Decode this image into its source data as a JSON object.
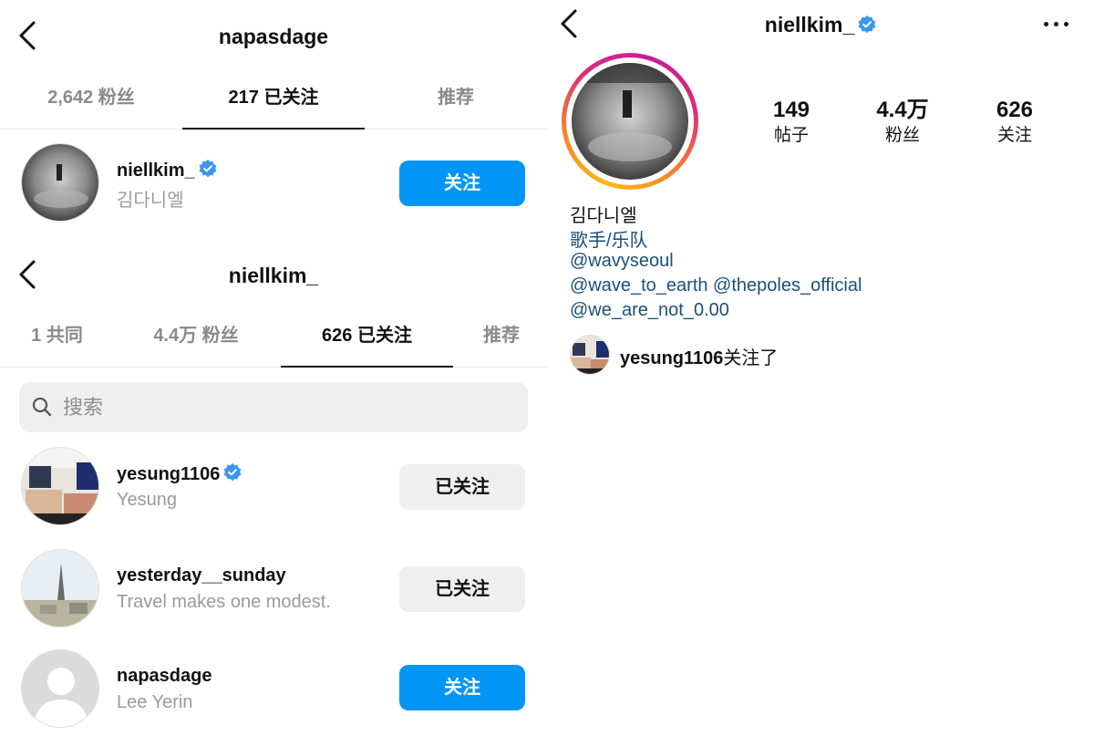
{
  "screen1": {
    "title": "napasdage",
    "tabs": [
      {
        "label": "2,642 粉丝",
        "active": false
      },
      {
        "label": "217 已关注",
        "active": true
      },
      {
        "label": "推荐",
        "active": false
      }
    ],
    "user": {
      "username": "niellkim_",
      "subtitle": "김다니엘",
      "verified": true,
      "button": "关注"
    }
  },
  "screen2": {
    "title": "niellkim_",
    "tabs": [
      {
        "label": "1 共同",
        "active": false
      },
      {
        "label": "4.4万 粉丝",
        "active": false
      },
      {
        "label": "626 已关注",
        "active": true
      },
      {
        "label": "推荐",
        "active": false
      }
    ],
    "search": {
      "placeholder": "搜索"
    },
    "list": [
      {
        "username": "yesung1106",
        "subtitle": "Yesung",
        "verified": true,
        "button": "已关注"
      },
      {
        "username": "yesterday__sunday",
        "subtitle": "Travel makes one modest.",
        "verified": false,
        "button": "已关注"
      },
      {
        "username": "napasdage",
        "subtitle": "Lee Yerin",
        "verified": false,
        "button": "关注"
      }
    ]
  },
  "profile": {
    "title": "niellkim_",
    "verified": true,
    "stats": [
      {
        "value": "149",
        "label": "帖子"
      },
      {
        "value": "4.4万",
        "label": "粉丝"
      },
      {
        "value": "626",
        "label": "关注"
      }
    ],
    "bio": {
      "name": "김다니엘",
      "category": "歌手/乐队",
      "lines": [
        "@wavyseoul",
        "@wave_to_earth @thepoles_official",
        "@we_are_not_0.00"
      ]
    },
    "followed_by": {
      "username": "yesung1106",
      "suffix": "关注了"
    }
  },
  "colors": {
    "accent": "#0095f6",
    "link": "#1b4f7a",
    "verified": "#3897f0",
    "muted": "#8a8a8a"
  }
}
